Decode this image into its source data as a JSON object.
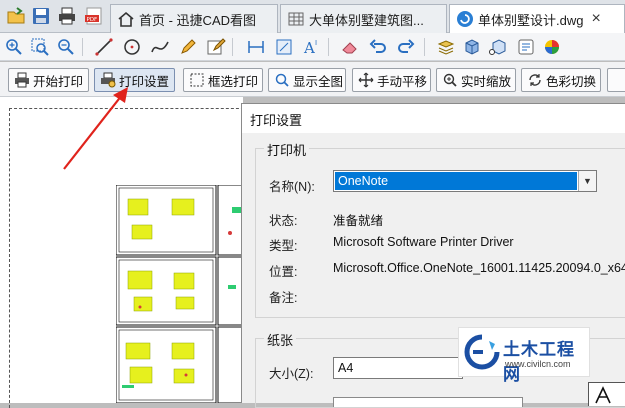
{
  "tabs": [
    {
      "label": "首页 - 迅捷CAD看图",
      "icon": "home-icon",
      "active": false
    },
    {
      "label": "大单体别墅建筑图...",
      "icon": "grid-icon",
      "active": false
    },
    {
      "label": "单体别墅设计.dwg",
      "icon": "cad-app-icon",
      "active": true
    }
  ],
  "tab_close": "×",
  "print_toolbar": {
    "start_print": "开始打印",
    "print_settings": "打印设置",
    "select_print": "框选打印",
    "show_all": "显示全图",
    "manual_pan": "手动平移",
    "realtime_zoom": "实时缩放",
    "color_switch": "色彩切换"
  },
  "dialog": {
    "title": "打印设置",
    "printer_group": "打印机",
    "name_label": "名称(N):",
    "name_value": "OneNote",
    "status_label": "状态:",
    "status_value": "准备就绪",
    "type_label": "类型:",
    "type_value": "Microsoft Software Printer Driver",
    "location_label": "位置:",
    "location_value": "Microsoft.Office.OneNote_16001.11425.20094.0_x64",
    "comment_label": "备注:",
    "paper_group": "纸张",
    "size_label": "大小(Z):",
    "size_value": "A4",
    "combo_arrow": "▼"
  },
  "watermark": {
    "title": "土木工程网",
    "url": "www.civilcn.com"
  },
  "colors": {
    "accent": "#0078d7",
    "arrow": "#e0231c",
    "logo": "#1b4fa3"
  }
}
